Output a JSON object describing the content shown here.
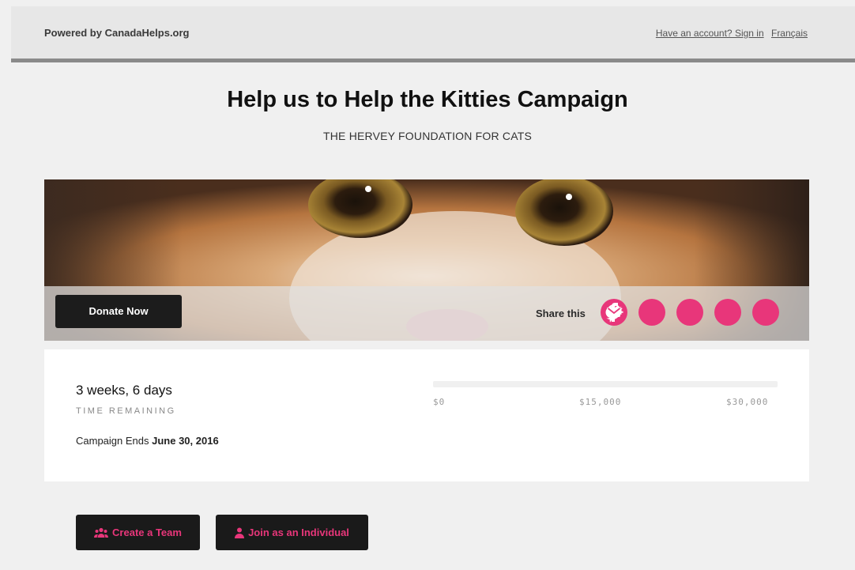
{
  "header": {
    "powered_by": "Powered by CanadaHelps.org",
    "sign_in": "Have an account? Sign in",
    "language": "Français"
  },
  "campaign": {
    "title": "Help us to Help the Kitties Campaign",
    "organization": "THE HERVEY FOUNDATION FOR CATS"
  },
  "hero": {
    "image": "kitten-face-closeup",
    "donate_label": "Donate Now",
    "share_label": "Share this",
    "share_icons": [
      "facebook-icon",
      "twitter-icon",
      "pinterest-icon",
      "google-plus-icon",
      "email-icon"
    ]
  },
  "stats": {
    "time_remaining": "3 weeks, 6 days",
    "time_label": "TIME REMAINING",
    "ends_prefix": "Campaign Ends",
    "ends_date": "June 30, 2016",
    "progress_fraction": 0,
    "scale": [
      "$0",
      "$15,000",
      "$30,000"
    ]
  },
  "actions": {
    "create_team": "Create a Team",
    "join_individual": "Join as an Individual"
  },
  "colors": {
    "accent": "#e8367a",
    "dark_button": "#1c1c1c"
  }
}
